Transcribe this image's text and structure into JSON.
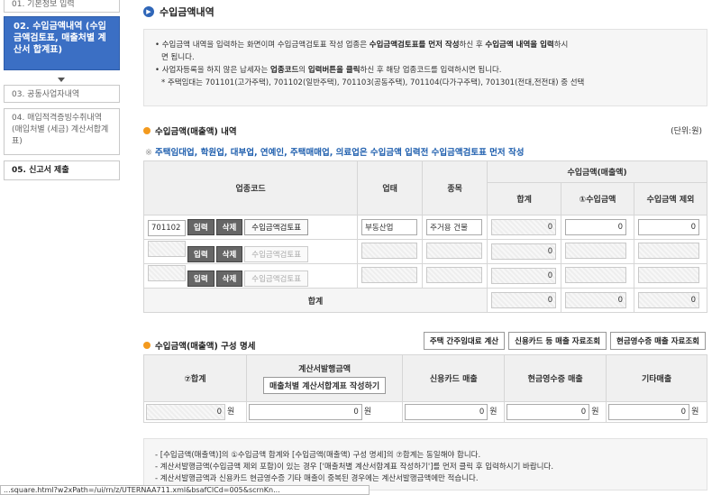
{
  "sidebar": {
    "items": [
      {
        "label": "01. 기본정보 입력"
      },
      {
        "label": "02. 수입금액내역 (수입금액검토표, 매출처별 계산서 합계표)"
      },
      {
        "label": "03. 공동사업자내역"
      },
      {
        "label": "04. 매입적격증빙수취내역 (매입처별 (세금) 계산서합계표)"
      },
      {
        "label": "05. 신고서 제출"
      }
    ]
  },
  "header": {
    "title": "수입금액내역"
  },
  "notes": {
    "line1_pre": "수입금액 내역을 입력하는 화면이며 수입금액검토표 작성 업종은 ",
    "line1_b1": "수입금액검토표를 먼저 작성",
    "line1_mid": "하신 후 ",
    "line1_b2": "수입금액 내역을 입력",
    "line1_post": "하시",
    "line1b": "면 됩니다.",
    "line2_pre": "사업자등록을 하지 않은 납세자는 ",
    "line2_b1": "업종코드",
    "line2_mid": "의 ",
    "line2_b2": "입력버튼을 클릭",
    "line2_post": "하신 후 해당 업종코드를 입력하시면 됩니다.",
    "line3": "* 주택임대는 701101(고가주택), 701102(일반주택), 701103(공동주택), 701104(다가구주택), 701301(전대,전전대) 중 선택"
  },
  "section1": {
    "title": "수입금액(매출액) 내역",
    "unit": "(단위:원)",
    "warning_mark": "※",
    "warning": "주택임대업, 학원업, 대부업, 연예인, 주택매매업, 의료업은 수입금액 입력전 수입금액검토표 먼저 작성",
    "headers": {
      "code": "업종코드",
      "type": "업태",
      "item": "종목",
      "revenue": "수입금액(매출액)",
      "total": "합계",
      "rev1": "①수입금액",
      "excluded": "수입금액 제외"
    },
    "rows": [
      {
        "code": "701102",
        "type": "부동산업",
        "item": "주거용 건물",
        "total": "0",
        "rev1": "0",
        "excluded": "0"
      },
      {
        "code": "",
        "type": "",
        "item": "",
        "total": "0",
        "rev1": "",
        "excluded": ""
      },
      {
        "code": "",
        "type": "",
        "item": "",
        "total": "0",
        "rev1": "",
        "excluded": ""
      }
    ],
    "sum_label": "합계",
    "sum": {
      "total": "0",
      "rev1": "0",
      "excluded": "0"
    },
    "btn_input": "입력",
    "btn_delete": "삭제",
    "btn_review": "수입금액검토표"
  },
  "section2": {
    "title": "수입금액(매출액) 구성 명세",
    "buttons": [
      "주택 간주임대료 계산",
      "신용카드 등 매출 자료조회",
      "현금영수증 매출 자료조회"
    ],
    "headers": {
      "total": "⑦합계",
      "invoice": "계산서발행금액",
      "invoice_btn": "매출처별 계산서합계표 작성하기",
      "card": "신용카드 매출",
      "cash": "현금영수증 매출",
      "etc": "기타매출"
    },
    "values": {
      "total": "0",
      "invoice": "0",
      "card": "0",
      "cash": "0",
      "etc": "0"
    },
    "won": "원"
  },
  "footer": {
    "line1": "- [수입금액(매출액)]의 ①수입금액 합계와 [수입금액(매출액) 구성 명세]의 ⑦합계는 동일해야 합니다.",
    "line2": "- 계산서발행금액(수입금액 제외 포함)이 있는 경우 ['매출처별 계산서합계표 작성하기']를 먼저 클릭 후 입력하시기 바랍니다.",
    "line3": "- 계산서발행금액과 신용카드 현금영수증 기타 매출이 중복된 경우에는 계산서발행금액에만 적습니다."
  },
  "statusbar": "...square.html?w2xPath=/ui/rn/z/UTERNAA711.xml&bsafClCd=005&scrnKn..."
}
